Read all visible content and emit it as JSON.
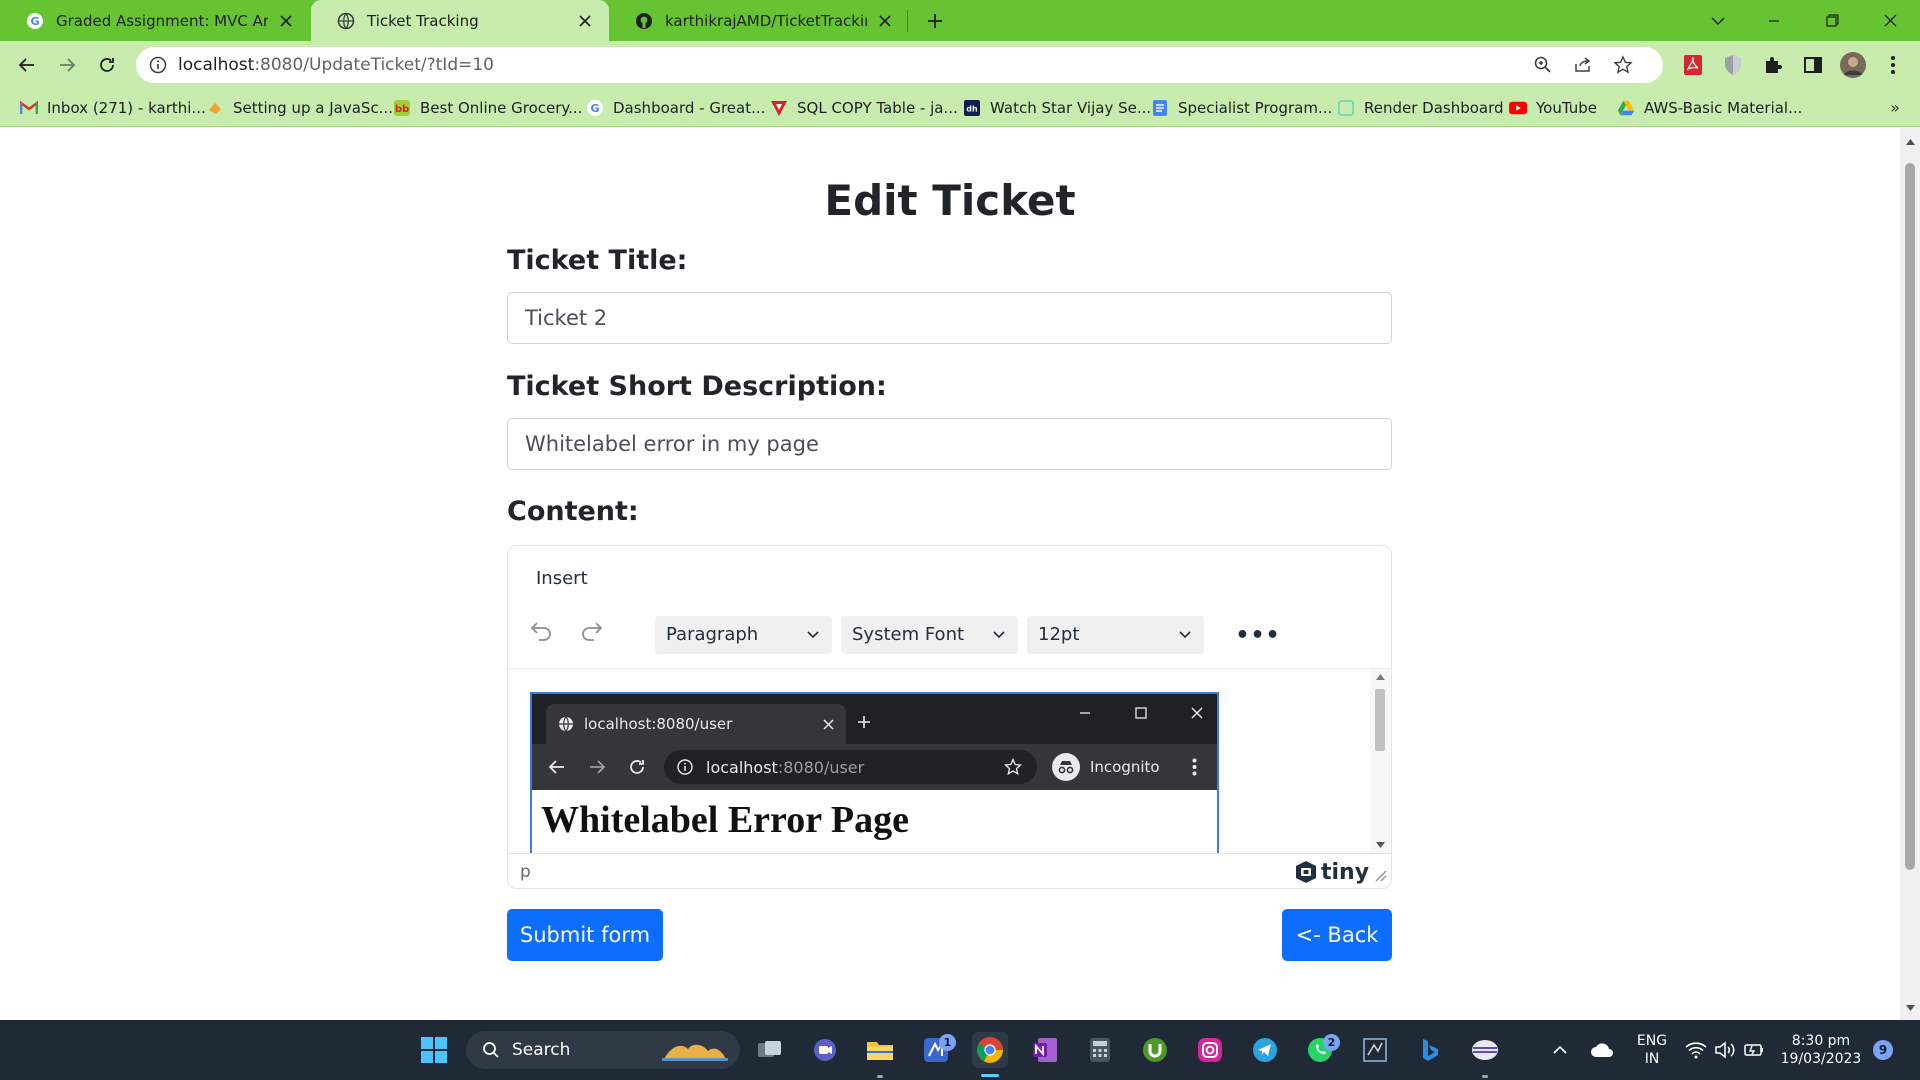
{
  "browser": {
    "tabs": [
      {
        "label": "Graded Assignment: MVC Archite",
        "favicon": "google-g-icon"
      },
      {
        "label": "Ticket Tracking",
        "favicon": "globe-icon"
      },
      {
        "label": "karthikrajAMD/TicketTracking",
        "favicon": "github-icon"
      }
    ],
    "url_host": "localhost",
    "url_rest": ":8080/UpdateTicket/?tId=10",
    "bookmarks": [
      {
        "label": "Inbox (271) - karthi...",
        "icon": "gmail-icon"
      },
      {
        "label": "Setting up a JavaSc...",
        "icon": "hand-icon"
      },
      {
        "label": "Best Online Grocery...",
        "icon": "bigbasket-icon"
      },
      {
        "label": "Dashboard - Great...",
        "icon": "google-g-icon"
      },
      {
        "label": "SQL COPY Table - ja...",
        "icon": "javatpoint-icon"
      },
      {
        "label": "Watch Star Vijay Se...",
        "icon": "hotstar-icon"
      },
      {
        "label": "Specialist Program...",
        "icon": "docs-icon"
      },
      {
        "label": "Render Dashboard",
        "icon": "render-icon"
      },
      {
        "label": "YouTube",
        "icon": "youtube-icon"
      },
      {
        "label": "AWS-Basic Material...",
        "icon": "drive-icon"
      }
    ],
    "bookmarks_more": "»"
  },
  "page": {
    "title": "Edit Ticket",
    "ticket_title_label": "Ticket Title:",
    "ticket_title_value": "Ticket 2",
    "short_desc_label": "Ticket Short Description:",
    "short_desc_value": "Whitelabel error in my page",
    "content_label": "Content:",
    "submit_label": "Submit form",
    "back_label": "<- Back"
  },
  "editor": {
    "menu_insert": "Insert",
    "block_format": "Paragraph",
    "font_family": "System Font",
    "font_size": "12pt",
    "more": "•••",
    "status_path": "p",
    "brand": "tiny",
    "embedded_image": {
      "tab_label": "localhost:8080/user",
      "url_host": "localhost",
      "url_rest": ":8080/user",
      "incognito_label": "Incognito",
      "heading": "Whitelabel Error Page"
    }
  },
  "taskbar": {
    "search_label": "Search",
    "teams_badge": "1",
    "whatsapp_badge": "2",
    "lang_line1": "ENG",
    "lang_line2": "IN",
    "time": "8:30 pm",
    "date": "19/03/2023",
    "notifications": "9"
  },
  "colors": {
    "tabbar": "#66c433",
    "toolbar": "#c8ebae",
    "primary_button": "#0d6efd",
    "taskbar": "#1f2a36"
  }
}
